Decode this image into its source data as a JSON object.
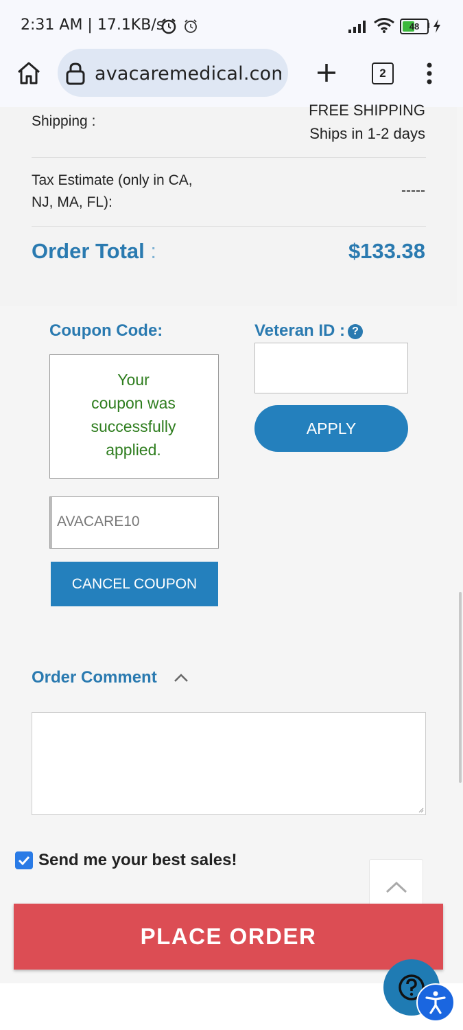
{
  "status": {
    "time": "2:31 AM | 17.1KB/s",
    "battery": "48"
  },
  "browser": {
    "url": "avacaremedical.com/c",
    "tab_count": "2"
  },
  "summary": {
    "shipping_label": "Shipping :",
    "shipping_value_1": "FREE SHIPPING",
    "shipping_value_2": "Ships in 1-2 days",
    "tax_label_1": "Tax Estimate (only in CA,",
    "tax_label_2": "NJ, MA, FL):",
    "tax_value": "-----",
    "total_label": "Order Total",
    "total_colon": ":",
    "total_value": "$133.38"
  },
  "coupon": {
    "heading": "Coupon Code:",
    "message_1": "Your",
    "message_2": "coupon was",
    "message_3": "successfully",
    "message_4": "applied.",
    "code": "AVACARE10",
    "cancel_label": "CANCEL COUPON"
  },
  "veteran": {
    "heading": "Veteran ID :",
    "help": "?",
    "apply_label": "APPLY"
  },
  "comment": {
    "heading": "Order Comment"
  },
  "newsletter": {
    "label": "Send me your best sales!",
    "checked": true
  },
  "place_order_label": "PLACE ORDER",
  "colors": {
    "accent": "#2a7ab0",
    "button": "#2480bd",
    "place_order": "#dc4d54",
    "success": "#2e7d1e"
  }
}
